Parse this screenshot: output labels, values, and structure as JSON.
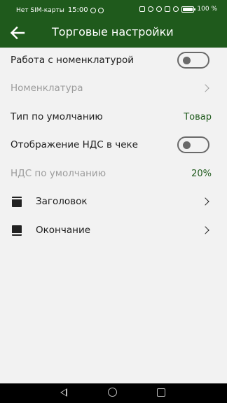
{
  "status_bar": {
    "carrier": "Нет SIM-карты",
    "time": "15:00",
    "battery": "100 %"
  },
  "appbar": {
    "title": "Торговые настройки",
    "back_icon": "arrow-left-icon"
  },
  "settings": {
    "nomenclature_work": {
      "label": "Работа с номенклатурой",
      "enabled": false
    },
    "nomenclature": {
      "label": "Номенклатура",
      "disabled": true
    },
    "default_type": {
      "label": "Тип по умолчанию",
      "value": "Товар"
    },
    "vat_display": {
      "label": "Отображение НДС в чеке",
      "enabled": false
    },
    "default_vat": {
      "label": "НДС по умолчанию",
      "value": "20%",
      "disabled": true
    },
    "header": {
      "label": "Заголовок",
      "icon": "document-header-icon"
    },
    "footer": {
      "label": "Окончание",
      "icon": "document-footer-icon"
    }
  },
  "colors": {
    "primary": "#1f5a1c",
    "background": "#f2f2f2",
    "disabled_text": "#9c9c9c"
  },
  "nav_bar": {
    "back_icon": "nav-back-icon",
    "home_icon": "nav-home-icon",
    "recent_icon": "nav-recents-icon"
  }
}
